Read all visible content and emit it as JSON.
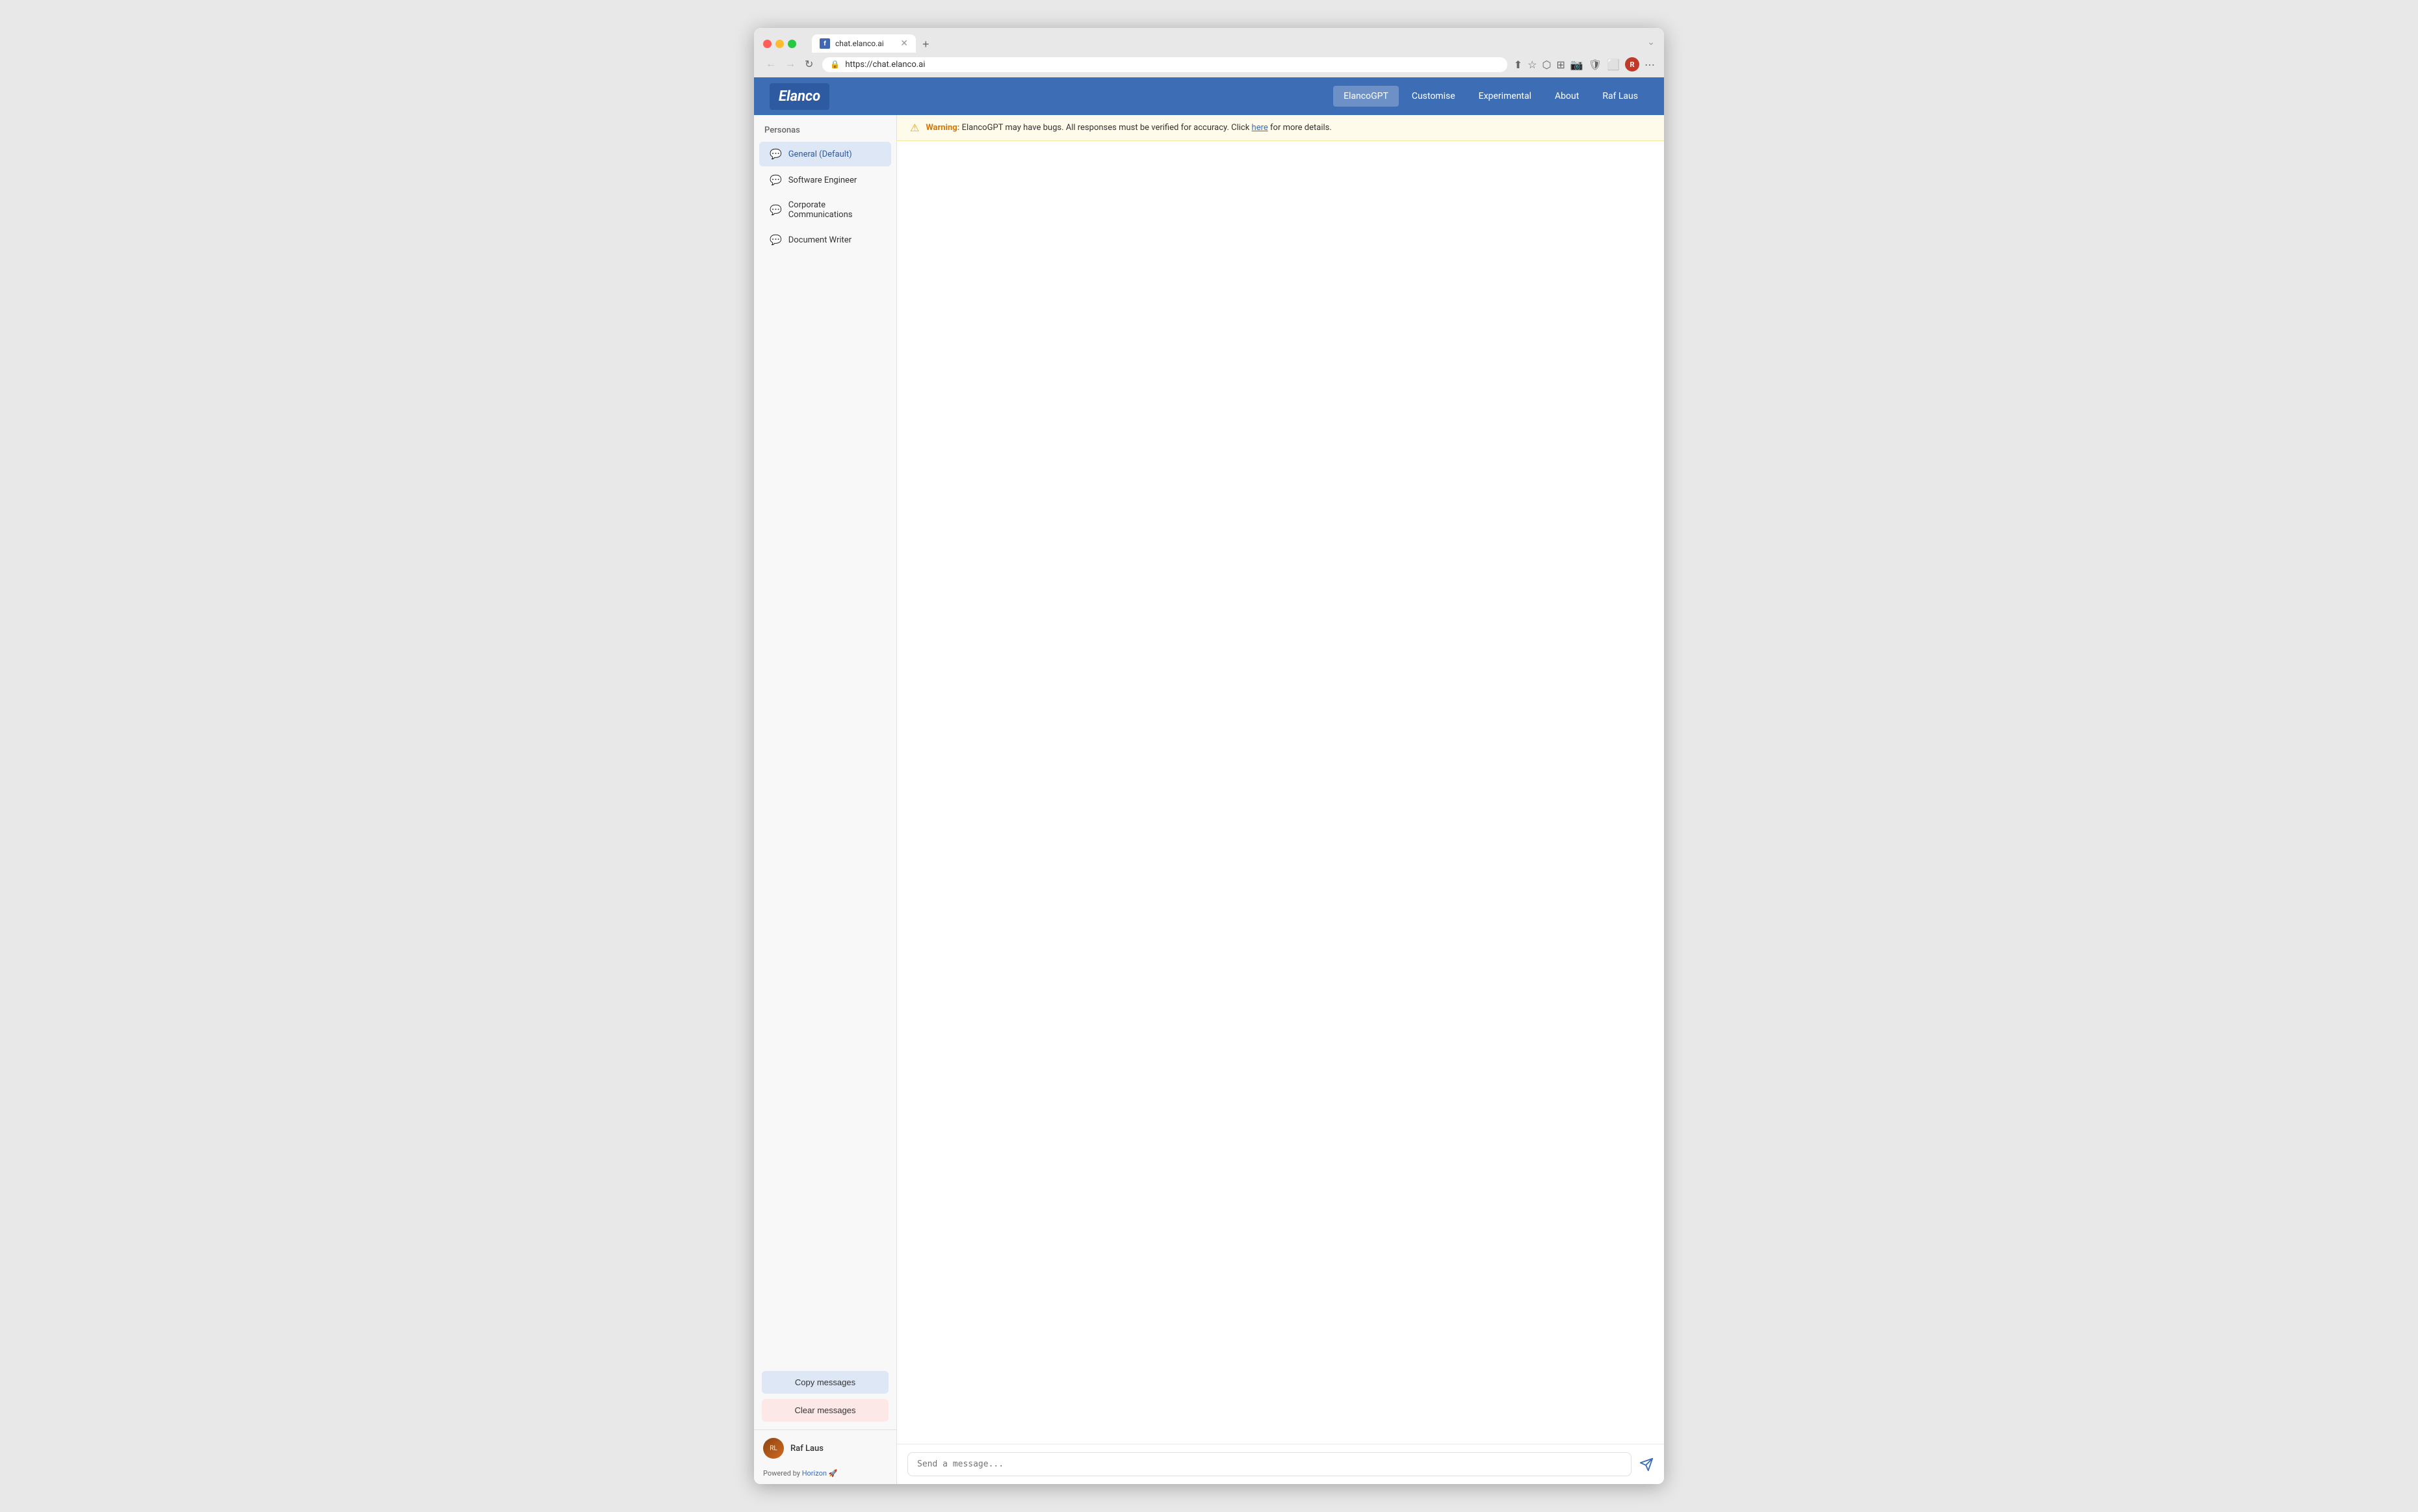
{
  "browser": {
    "tab_favicon": "f",
    "tab_title": "chat.elanco.ai",
    "url": "https://chat.elanco.ai",
    "new_tab_label": "+",
    "nav": {
      "back": "←",
      "forward": "→",
      "refresh": "↻"
    }
  },
  "nav": {
    "logo": "Elanco",
    "items": [
      {
        "label": "ElancoGPT",
        "active": true
      },
      {
        "label": "Customise",
        "active": false
      },
      {
        "label": "Experimental",
        "active": false
      },
      {
        "label": "About",
        "active": false
      },
      {
        "label": "Raf Laus",
        "active": false
      }
    ]
  },
  "sidebar": {
    "section_label": "Personas",
    "personas": [
      {
        "label": "General (Default)",
        "active": true
      },
      {
        "label": "Software Engineer",
        "active": false
      },
      {
        "label": "Corporate Communications",
        "active": false
      },
      {
        "label": "Document Writer",
        "active": false
      }
    ],
    "copy_btn": "Copy messages",
    "clear_btn": "Clear messages",
    "user_name": "Raf Laus",
    "powered_by_prefix": "Powered by ",
    "powered_by_link": "Horizon",
    "powered_by_emoji": "🚀"
  },
  "warning": {
    "prefix": "Warning:",
    "message": " ElancoGPT may have bugs. All responses must be verified for accuracy. Click ",
    "link_text": "here",
    "suffix": " for more details."
  },
  "chat": {
    "input_placeholder": "Send a message..."
  }
}
